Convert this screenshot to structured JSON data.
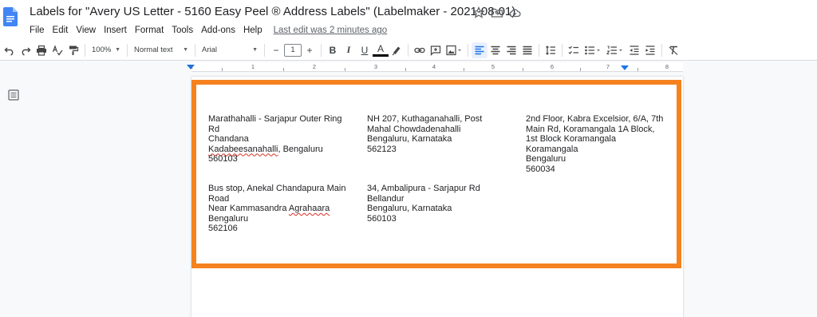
{
  "doc": {
    "title": "Labels for \"Avery US Letter - 5160 Easy Peel ® Address Labels\" (Labelmaker - 2021-08-01)",
    "brand_color": "#4285f4",
    "title_icons": [
      "star-icon",
      "move-to-folder-icon",
      "cloud-saved-icon"
    ]
  },
  "menu": {
    "items": [
      "File",
      "Edit",
      "View",
      "Insert",
      "Format",
      "Tools",
      "Add-ons",
      "Help"
    ],
    "last_edit": "Last edit was 2 minutes ago"
  },
  "toolbar": {
    "zoom": "100%",
    "style": "Normal text",
    "font": "Arial",
    "font_size": "1",
    "minus": "−",
    "plus": "+",
    "bold": "B",
    "italic": "I",
    "underline": "U",
    "text_color": "A"
  },
  "ruler": {
    "numbers": [
      "1",
      "1",
      "2",
      "3",
      "4",
      "5",
      "6",
      "7",
      "8"
    ]
  },
  "labels": [
    {
      "lines": [
        "Marathahalli - Sarjapur Outer Ring",
        "Rd",
        "Chandana"
      ],
      "spell_word": "Kadabeesanahalli",
      "spell_rest": ", Bengaluru",
      "after": [
        "560103"
      ]
    },
    {
      "lines": [
        "NH 207, Kuthaganahalli, Post",
        "Mahal Chowdadenahalli",
        "Bengaluru, Karnataka",
        "562123"
      ]
    },
    {
      "lines": [
        "2nd Floor, Kabra Excelsior, 6/A, 7th",
        "Main Rd, Koramangala 1A Block,",
        "1st Block Koramangala",
        "Koramangala",
        "Bengaluru",
        "560034"
      ]
    },
    {
      "lines": [
        "Bus stop, Anekal Chandapura Main",
        "Road"
      ],
      "spell_prefix": "Near Kammasandra ",
      "spell_word": "Agrahaara",
      "after": [
        "Bengaluru",
        "562106"
      ]
    },
    {
      "lines": [
        "34, Ambalipura - Sarjapur Rd",
        "Bellandur",
        "Bengaluru, Karnataka",
        "560103"
      ]
    }
  ],
  "colors": {
    "highlight": "#f5821f",
    "accent": "#1a73e8",
    "spellcheck": "#d93025"
  }
}
